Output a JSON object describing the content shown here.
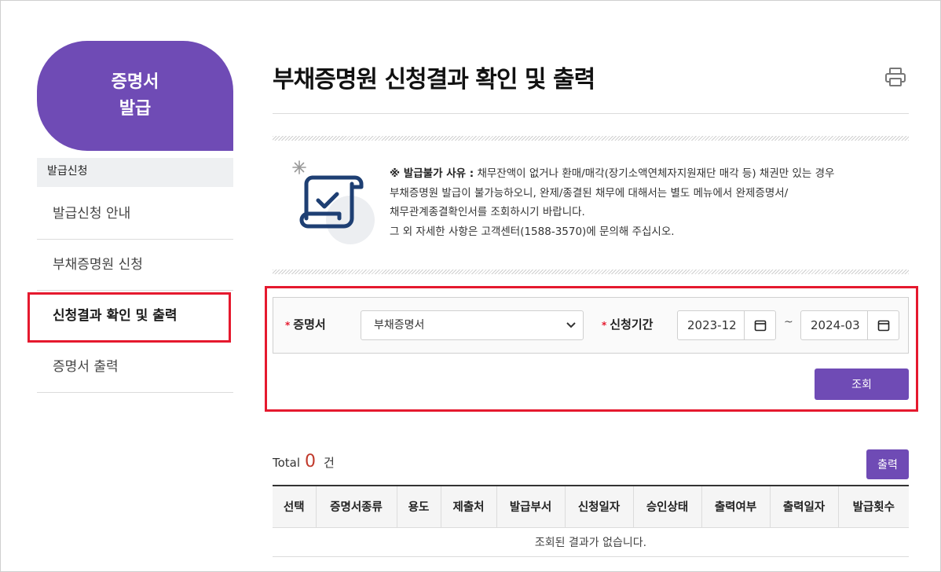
{
  "sidebar": {
    "title": "증명서\n발급",
    "group_label": "발급신청",
    "items": [
      {
        "label": "발급신청 안내",
        "active": false
      },
      {
        "label": "부채증명원 신청",
        "active": false
      },
      {
        "label": "신청결과 확인 및 출력",
        "active": true
      },
      {
        "label": "증명서 출력",
        "active": false
      }
    ]
  },
  "page": {
    "title": "부채증명원 신청결과 확인 및 출력",
    "print_icon": "printer-icon"
  },
  "notice": {
    "prefix": "※ 발급불가 사유 :",
    "line1": " 채무잔액이 없거나 환매/매각(장기소액연체자지원재단 매각 등) 채권만 있는 경우",
    "line2": "부채증명원 발급이 불가능하오니, 완제/종결된 채무에 대해서는 별도 메뉴에서 완제증명서/",
    "line3": "채무관계종결확인서를 조회하시기 바랍니다.",
    "line4": "그 외 자세한 사항은 고객센터(1588-3570)에 문의해 주십시오.",
    "icon": "certificate-scroll-icon"
  },
  "search": {
    "cert_label": "증명서",
    "cert_selected": "부채증명서",
    "period_label": "신청기간",
    "date_from": "2023-12",
    "date_to": "2024-03",
    "tilde": "~",
    "search_button": "조회"
  },
  "results": {
    "total_label": "Total",
    "total_count": "0",
    "total_unit": "건",
    "print_button": "출력",
    "columns": [
      "선택",
      "증명서종류",
      "용도",
      "제출처",
      "발급부서",
      "신청일자",
      "승인상태",
      "출력여부",
      "출력일자",
      "발급횟수"
    ],
    "empty_message": "조회된 결과가 없습니다."
  },
  "colors": {
    "accent": "#6f4bb5",
    "highlight": "#e5192e",
    "required": "#e5192e"
  }
}
